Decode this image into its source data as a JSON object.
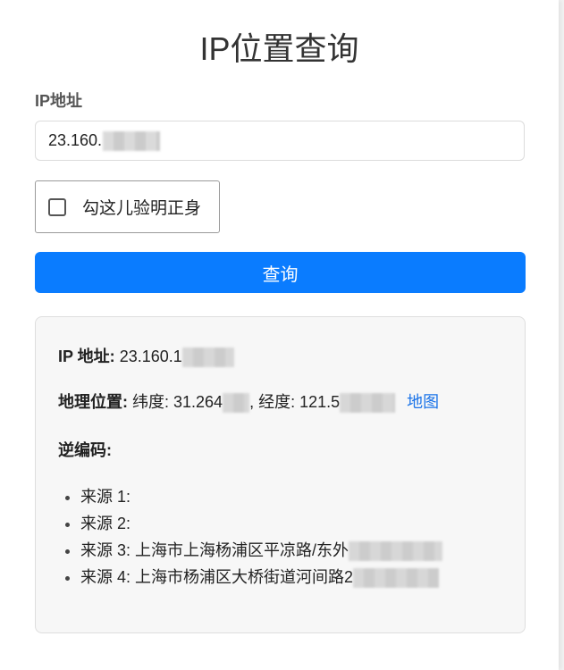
{
  "page": {
    "title": "IP位置查询"
  },
  "form": {
    "ip_label": "IP地址",
    "ip_value": "23.160.",
    "verify_label": "勾这儿验明正身",
    "query_button": "查询"
  },
  "result": {
    "ip_label": "IP 地址:",
    "ip_value": "23.160.1",
    "geo_label": "地理位置:",
    "lat_text": "纬度: 31.264",
    "lng_text": ", 经度: 121.5",
    "map_link": "地图",
    "reverse_label": "逆编码:",
    "sources": [
      {
        "text": "来源 1:"
      },
      {
        "text": "来源 2:"
      },
      {
        "text": "来源 3: 上海市上海杨浦区平凉路/东外"
      },
      {
        "text": "来源 4: 上海市杨浦区大桥街道河间路2"
      }
    ]
  },
  "colors": {
    "accent": "#0a7cff",
    "link": "#1a73e8"
  }
}
